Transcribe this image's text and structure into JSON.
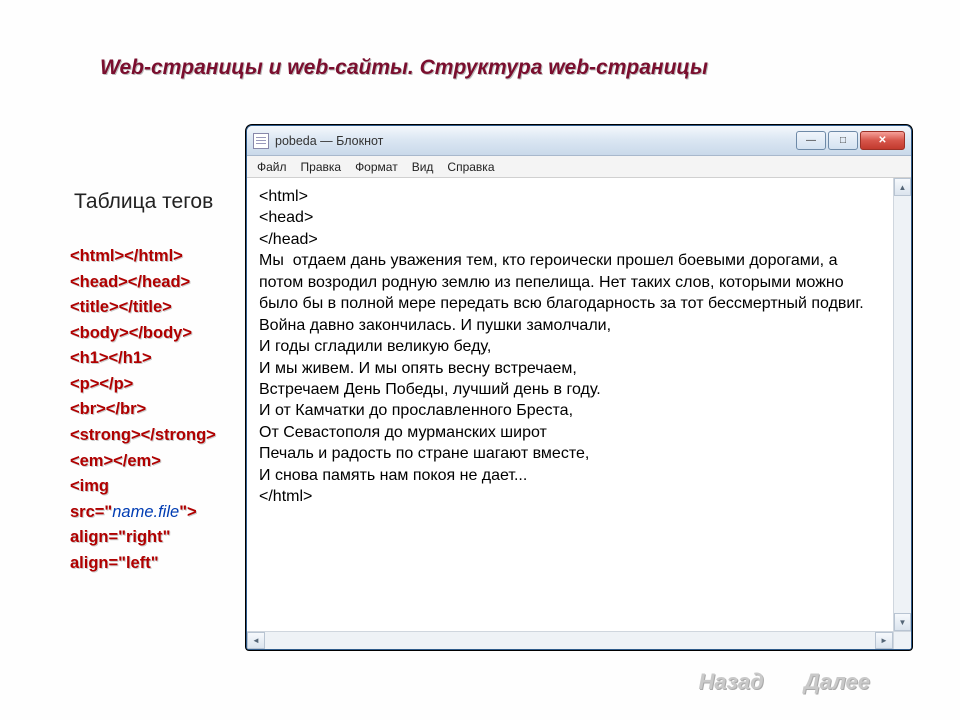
{
  "slide": {
    "title": "Web-страницы и web-сайты. Структура web-страницы"
  },
  "left": {
    "heading": "Таблица тегов",
    "tags": [
      {
        "open": "<html>",
        "close": "</html>"
      },
      {
        "open": "<head>",
        "close": "</head>"
      },
      {
        "open": "<title>",
        "close": "</title>"
      },
      {
        "open": "<body>",
        "close": "</body>"
      },
      {
        "open": "<h1>",
        "close": "</h1>"
      },
      {
        "open": "<p>",
        "close": "</p>"
      },
      {
        "open": "<br>",
        "close": "</br>"
      },
      {
        "open": "<strong>",
        "close": "</strong>"
      },
      {
        "open": "<em>",
        "close": "</em>"
      }
    ],
    "img_prefix": "<img src=\"",
    "img_file": "name.file",
    "img_suffix": "\">",
    "align_right": "align=\"right\"",
    "align_left": "align=\"left\""
  },
  "notepad": {
    "title": "pobeda — Блокнот",
    "menu": {
      "file": "Файл",
      "edit": "Правка",
      "format": "Формат",
      "view": "Вид",
      "help": "Справка"
    },
    "content": "<html>\n<head>\n</head>\nМы  отдаем дань уважения тем, кто героически прошел боевыми дорогами, а потом возродил родную землю из пепелища. Нет таких слов, которыми можно было бы в полной мере передать всю благодарность за тот бессмертный подвиг.\nВойна давно закончилась. И пушки замолчали,\nИ годы сгладили великую беду,\nИ мы живем. И мы опять весну встречаем,\nВстречаем День Победы, лучший день в году.\nИ от Камчатки до прославленного Бреста,\nОт Севастополя до мурманских широт\nПечаль и радость по стране шагают вместе,\nИ снова память нам покоя не дает...\n</html>"
  },
  "nav": {
    "back": "Назад",
    "next": "Далее"
  }
}
